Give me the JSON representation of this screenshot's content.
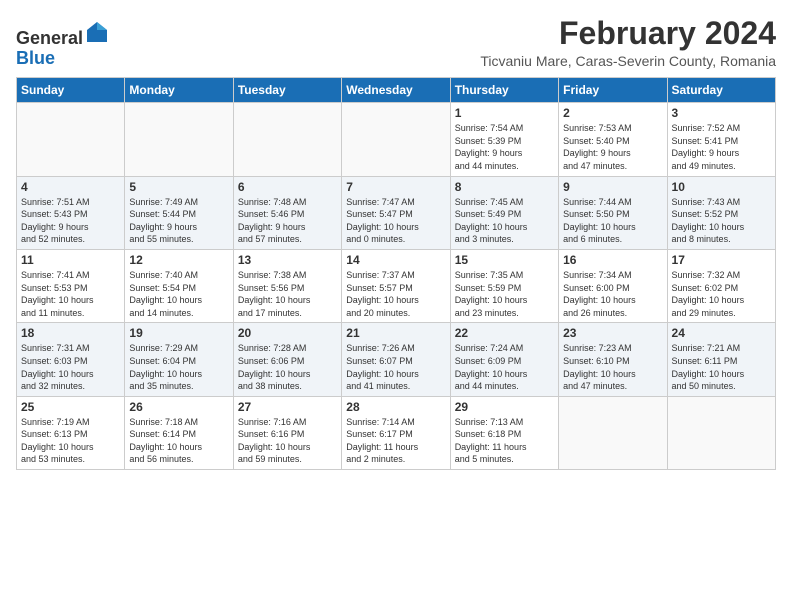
{
  "header": {
    "logo_general": "General",
    "logo_blue": "Blue",
    "month_title": "February 2024",
    "subtitle": "Ticvaniu Mare, Caras-Severin County, Romania"
  },
  "weekdays": [
    "Sunday",
    "Monday",
    "Tuesday",
    "Wednesday",
    "Thursday",
    "Friday",
    "Saturday"
  ],
  "weeks": [
    {
      "shaded": false,
      "days": [
        {
          "num": "",
          "info": ""
        },
        {
          "num": "",
          "info": ""
        },
        {
          "num": "",
          "info": ""
        },
        {
          "num": "",
          "info": ""
        },
        {
          "num": "1",
          "info": "Sunrise: 7:54 AM\nSunset: 5:39 PM\nDaylight: 9 hours\nand 44 minutes."
        },
        {
          "num": "2",
          "info": "Sunrise: 7:53 AM\nSunset: 5:40 PM\nDaylight: 9 hours\nand 47 minutes."
        },
        {
          "num": "3",
          "info": "Sunrise: 7:52 AM\nSunset: 5:41 PM\nDaylight: 9 hours\nand 49 minutes."
        }
      ]
    },
    {
      "shaded": true,
      "days": [
        {
          "num": "4",
          "info": "Sunrise: 7:51 AM\nSunset: 5:43 PM\nDaylight: 9 hours\nand 52 minutes."
        },
        {
          "num": "5",
          "info": "Sunrise: 7:49 AM\nSunset: 5:44 PM\nDaylight: 9 hours\nand 55 minutes."
        },
        {
          "num": "6",
          "info": "Sunrise: 7:48 AM\nSunset: 5:46 PM\nDaylight: 9 hours\nand 57 minutes."
        },
        {
          "num": "7",
          "info": "Sunrise: 7:47 AM\nSunset: 5:47 PM\nDaylight: 10 hours\nand 0 minutes."
        },
        {
          "num": "8",
          "info": "Sunrise: 7:45 AM\nSunset: 5:49 PM\nDaylight: 10 hours\nand 3 minutes."
        },
        {
          "num": "9",
          "info": "Sunrise: 7:44 AM\nSunset: 5:50 PM\nDaylight: 10 hours\nand 6 minutes."
        },
        {
          "num": "10",
          "info": "Sunrise: 7:43 AM\nSunset: 5:52 PM\nDaylight: 10 hours\nand 8 minutes."
        }
      ]
    },
    {
      "shaded": false,
      "days": [
        {
          "num": "11",
          "info": "Sunrise: 7:41 AM\nSunset: 5:53 PM\nDaylight: 10 hours\nand 11 minutes."
        },
        {
          "num": "12",
          "info": "Sunrise: 7:40 AM\nSunset: 5:54 PM\nDaylight: 10 hours\nand 14 minutes."
        },
        {
          "num": "13",
          "info": "Sunrise: 7:38 AM\nSunset: 5:56 PM\nDaylight: 10 hours\nand 17 minutes."
        },
        {
          "num": "14",
          "info": "Sunrise: 7:37 AM\nSunset: 5:57 PM\nDaylight: 10 hours\nand 20 minutes."
        },
        {
          "num": "15",
          "info": "Sunrise: 7:35 AM\nSunset: 5:59 PM\nDaylight: 10 hours\nand 23 minutes."
        },
        {
          "num": "16",
          "info": "Sunrise: 7:34 AM\nSunset: 6:00 PM\nDaylight: 10 hours\nand 26 minutes."
        },
        {
          "num": "17",
          "info": "Sunrise: 7:32 AM\nSunset: 6:02 PM\nDaylight: 10 hours\nand 29 minutes."
        }
      ]
    },
    {
      "shaded": true,
      "days": [
        {
          "num": "18",
          "info": "Sunrise: 7:31 AM\nSunset: 6:03 PM\nDaylight: 10 hours\nand 32 minutes."
        },
        {
          "num": "19",
          "info": "Sunrise: 7:29 AM\nSunset: 6:04 PM\nDaylight: 10 hours\nand 35 minutes."
        },
        {
          "num": "20",
          "info": "Sunrise: 7:28 AM\nSunset: 6:06 PM\nDaylight: 10 hours\nand 38 minutes."
        },
        {
          "num": "21",
          "info": "Sunrise: 7:26 AM\nSunset: 6:07 PM\nDaylight: 10 hours\nand 41 minutes."
        },
        {
          "num": "22",
          "info": "Sunrise: 7:24 AM\nSunset: 6:09 PM\nDaylight: 10 hours\nand 44 minutes."
        },
        {
          "num": "23",
          "info": "Sunrise: 7:23 AM\nSunset: 6:10 PM\nDaylight: 10 hours\nand 47 minutes."
        },
        {
          "num": "24",
          "info": "Sunrise: 7:21 AM\nSunset: 6:11 PM\nDaylight: 10 hours\nand 50 minutes."
        }
      ]
    },
    {
      "shaded": false,
      "days": [
        {
          "num": "25",
          "info": "Sunrise: 7:19 AM\nSunset: 6:13 PM\nDaylight: 10 hours\nand 53 minutes."
        },
        {
          "num": "26",
          "info": "Sunrise: 7:18 AM\nSunset: 6:14 PM\nDaylight: 10 hours\nand 56 minutes."
        },
        {
          "num": "27",
          "info": "Sunrise: 7:16 AM\nSunset: 6:16 PM\nDaylight: 10 hours\nand 59 minutes."
        },
        {
          "num": "28",
          "info": "Sunrise: 7:14 AM\nSunset: 6:17 PM\nDaylight: 11 hours\nand 2 minutes."
        },
        {
          "num": "29",
          "info": "Sunrise: 7:13 AM\nSunset: 6:18 PM\nDaylight: 11 hours\nand 5 minutes."
        },
        {
          "num": "",
          "info": ""
        },
        {
          "num": "",
          "info": ""
        }
      ]
    }
  ]
}
